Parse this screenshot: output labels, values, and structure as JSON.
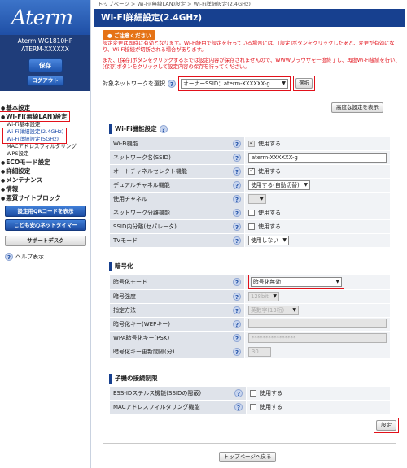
{
  "sidebar": {
    "logo": "Aterm",
    "model": "Aterm WG1810HP",
    "device_id": "ATERM-XXXXXX",
    "save_label": "保存",
    "logout_label": "ログアウト",
    "menu": [
      {
        "label": "基本設定"
      },
      {
        "label": "Wi-Fi(無線LAN)設定",
        "subs": [
          "Wi-Fi基本設定",
          "Wi-Fi詳細設定(2.4GHz)",
          "Wi-Fi詳細設定(5GHz)",
          "MACアドレスフィルタリング",
          "WPS設定"
        ]
      },
      {
        "label": "ECOモード設定"
      },
      {
        "label": "詳細設定"
      },
      {
        "label": "メンテナンス"
      },
      {
        "label": "情報"
      },
      {
        "label": "悪質サイトブロック"
      }
    ],
    "qr_button": "設定用QRコードを表示",
    "kids_button": "こども安心ネットタイマー",
    "support_button": "サポートデスク",
    "help_label": "ヘルプ表示"
  },
  "header": {
    "breadcrumb": "トップページ > Wi-Fi(無線LAN)設定 > Wi-Fi詳細設定(2.4GHz)",
    "title": "Wi-Fi詳細設定(2.4GHz)"
  },
  "caution": {
    "heading": "ご注意ください",
    "p1": "設定変更は即時に有効となります。Wi-Fi経由で設定を行っている場合には、[設定]ボタンをクリックしたあと、変更が有効になり、Wi-Fi接続が切断される場合があります。",
    "p2": "また、[保存]ボタンをクリックするまでは設定内容が保存されませんので、WWWブラウザを一度終了し、再度Wi-Fi接続を行い、[保存]ボタンをクリックして設定内容の保存を行ってください。"
  },
  "target": {
    "label": "対象ネットワークを選択",
    "value": "オーナーSSID：aterm-XXXXXX-g",
    "select_button": "選択"
  },
  "advanced_button": "高度な設定を表示",
  "wifi_section": {
    "heading": "Wi-Fi機能設定",
    "rows": {
      "wifi_function": {
        "label": "Wi-Fi機能",
        "value": "使用する"
      },
      "ssid": {
        "label": "ネットワーク名(SSID)",
        "value": "aterm-XXXXXX-g"
      },
      "auto_channel": {
        "label": "オートチャネルセレクト機能",
        "value": "使用する"
      },
      "dual_channel": {
        "label": "デュアルチャネル機能",
        "value": "使用する(自動切替)"
      },
      "channel": {
        "label": "使用チャネル",
        "value": ""
      },
      "net_sep": {
        "label": "ネットワーク分離機能",
        "value": "使用する"
      },
      "ssid_sep": {
        "label": "SSID内分離(セパレータ)",
        "value": "使用する"
      },
      "tv_mode": {
        "label": "TVモード",
        "value": "使用しない"
      }
    }
  },
  "enc_section": {
    "heading": "暗号化",
    "rows": {
      "mode": {
        "label": "暗号化モード",
        "value": "暗号化無効"
      },
      "strength": {
        "label": "暗号強度",
        "value": "128bit"
      },
      "method": {
        "label": "指定方法",
        "value": "英数字(13桁)"
      },
      "wep_key": {
        "label": "暗号化キー(WEPキー)",
        "value": ""
      },
      "psk": {
        "label": "WPA暗号化キー(PSK)",
        "value": "****************"
      },
      "interval": {
        "label": "暗号化キー更新間隔(分)",
        "value": "30"
      }
    }
  },
  "child_section": {
    "heading": "子機の接続制限",
    "rows": {
      "stealth": {
        "label": "ESS-IDステルス機能(SSIDの隠蔽)",
        "value": "使用する"
      },
      "mac_filter": {
        "label": "MACアドレスフィルタリング機能",
        "value": "使用する"
      }
    }
  },
  "set_button": "設定",
  "top_button": "トップページへ戻る"
}
